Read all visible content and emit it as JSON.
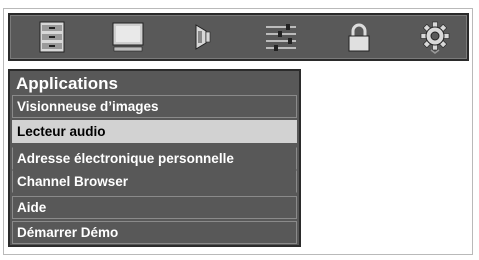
{
  "colors": {
    "bar_bg": "#595959",
    "menu_bg": "#585858",
    "selected_bg": "#d2d2d2",
    "text": "#ffffff",
    "selected_text": "#000000"
  },
  "icon_tabs": [
    {
      "name": "setup-list-icon"
    },
    {
      "name": "picture-monitor-icon"
    },
    {
      "name": "speaker-icon"
    },
    {
      "name": "equalizer-sliders-icon"
    },
    {
      "name": "lock-icon"
    },
    {
      "name": "gear-icon"
    }
  ],
  "menu": {
    "title": "Applications",
    "items": [
      {
        "label": "Visionneuse d’images"
      },
      {
        "label": "Lecteur audio"
      },
      {
        "label": "Adresse électronique personnelle"
      },
      {
        "label": "Channel Browser"
      },
      {
        "label": "Aide"
      },
      {
        "label": "Démarrer Démo"
      }
    ],
    "selected_index": 1
  }
}
